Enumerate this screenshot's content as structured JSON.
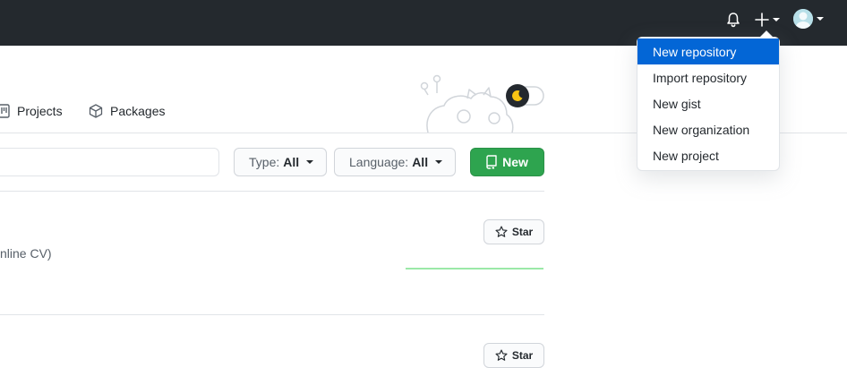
{
  "header": {
    "notifications_icon": "bell-icon",
    "create_icon": "plus-icon",
    "avatar_icon": "avatar"
  },
  "tabs": [
    {
      "label": "Projects",
      "icon": "project-board-icon"
    },
    {
      "label": "Packages",
      "icon": "package-icon"
    }
  ],
  "filters": {
    "type_label": "Type:",
    "type_value": "All",
    "language_label": "Language:",
    "language_value": "All",
    "new_label": "New"
  },
  "repos": [
    {
      "description": "nline CV)",
      "star_label": "Star"
    },
    {
      "description": "",
      "star_label": "Star"
    }
  ],
  "create_menu": {
    "items": [
      {
        "label": "New repository"
      },
      {
        "label": "Import repository"
      },
      {
        "label": "New gist"
      },
      {
        "label": "New organization"
      },
      {
        "label": "New project"
      }
    ]
  },
  "colors": {
    "header_bg": "#24292e",
    "primary_button": "#2ea44f",
    "menu_highlight": "#0366d6",
    "contribution_line": "#9be9a8"
  }
}
